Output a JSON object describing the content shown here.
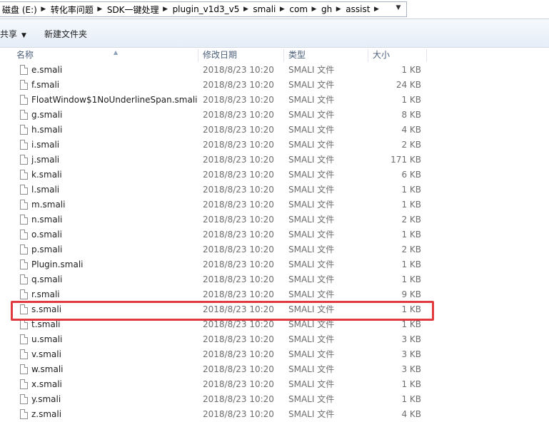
{
  "address": {
    "crumbs": [
      "磁盘 (E:)",
      "转化率问题",
      "SDK一键处理",
      "plugin_v1d3_v5",
      "smali",
      "com",
      "gh",
      "assist"
    ],
    "separator_icon": "chevron-right-icon",
    "dropdown_icon": "chevron-down-icon"
  },
  "toolbar": {
    "share_label": "共享",
    "share_caret": "▼",
    "new_folder_label": "新建文件夹"
  },
  "columns": {
    "name": "名称",
    "date": "修改日期",
    "type": "类型",
    "size": "大小",
    "sort_icon": "sort-up-icon"
  },
  "files": [
    {
      "name": "e.smali",
      "date": "2018/8/23 10:20",
      "type": "SMALI 文件",
      "size": "1 KB"
    },
    {
      "name": "f.smali",
      "date": "2018/8/23 10:20",
      "type": "SMALI 文件",
      "size": "24 KB"
    },
    {
      "name": "FloatWindow$1NoUnderlineSpan.smali",
      "date": "2018/8/23 10:20",
      "type": "SMALI 文件",
      "size": "1 KB"
    },
    {
      "name": "g.smali",
      "date": "2018/8/23 10:20",
      "type": "SMALI 文件",
      "size": "8 KB"
    },
    {
      "name": "h.smali",
      "date": "2018/8/23 10:20",
      "type": "SMALI 文件",
      "size": "4 KB"
    },
    {
      "name": "i.smali",
      "date": "2018/8/23 10:20",
      "type": "SMALI 文件",
      "size": "2 KB"
    },
    {
      "name": "j.smali",
      "date": "2018/8/23 10:20",
      "type": "SMALI 文件",
      "size": "171 KB"
    },
    {
      "name": "k.smali",
      "date": "2018/8/23 10:20",
      "type": "SMALI 文件",
      "size": "6 KB"
    },
    {
      "name": "l.smali",
      "date": "2018/8/23 10:20",
      "type": "SMALI 文件",
      "size": "1 KB"
    },
    {
      "name": "m.smali",
      "date": "2018/8/23 10:20",
      "type": "SMALI 文件",
      "size": "1 KB"
    },
    {
      "name": "n.smali",
      "date": "2018/8/23 10:20",
      "type": "SMALI 文件",
      "size": "2 KB"
    },
    {
      "name": "o.smali",
      "date": "2018/8/23 10:20",
      "type": "SMALI 文件",
      "size": "1 KB"
    },
    {
      "name": "p.smali",
      "date": "2018/8/23 10:20",
      "type": "SMALI 文件",
      "size": "2 KB"
    },
    {
      "name": "Plugin.smali",
      "date": "2018/8/23 10:20",
      "type": "SMALI 文件",
      "size": "1 KB"
    },
    {
      "name": "q.smali",
      "date": "2018/8/23 10:20",
      "type": "SMALI 文件",
      "size": "1 KB"
    },
    {
      "name": "r.smali",
      "date": "2018/8/23 10:20",
      "type": "SMALI 文件",
      "size": "9 KB"
    },
    {
      "name": "s.smali",
      "date": "2018/8/23 10:20",
      "type": "SMALI 文件",
      "size": "1 KB"
    },
    {
      "name": "t.smali",
      "date": "2018/8/23 10:20",
      "type": "SMALI 文件",
      "size": "1 KB"
    },
    {
      "name": "u.smali",
      "date": "2018/8/23 10:20",
      "type": "SMALI 文件",
      "size": "3 KB"
    },
    {
      "name": "v.smali",
      "date": "2018/8/23 10:20",
      "type": "SMALI 文件",
      "size": "3 KB"
    },
    {
      "name": "w.smali",
      "date": "2018/8/23 10:20",
      "type": "SMALI 文件",
      "size": "3 KB"
    },
    {
      "name": "x.smali",
      "date": "2018/8/23 10:20",
      "type": "SMALI 文件",
      "size": "1 KB"
    },
    {
      "name": "y.smali",
      "date": "2018/8/23 10:20",
      "type": "SMALI 文件",
      "size": "1 KB"
    },
    {
      "name": "z.smali",
      "date": "2018/8/23 10:20",
      "type": "SMALI 文件",
      "size": "4 KB"
    }
  ],
  "file_icon": "document-icon",
  "highlight_color": "#e03a3e"
}
